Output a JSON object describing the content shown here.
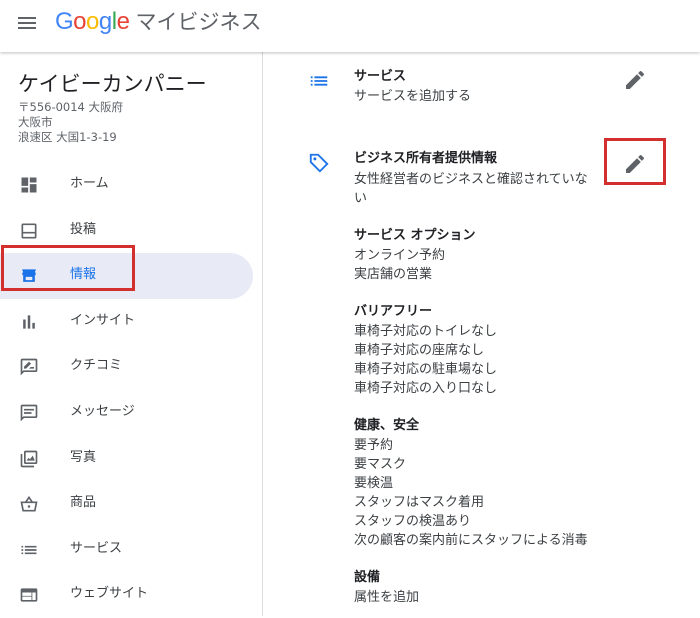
{
  "header": {
    "logo_letters": [
      {
        "ch": "G",
        "color": "#4285F4"
      },
      {
        "ch": "o",
        "color": "#EA4335"
      },
      {
        "ch": "o",
        "color": "#FBBC05"
      },
      {
        "ch": "g",
        "color": "#4285F4"
      },
      {
        "ch": "l",
        "color": "#34A853"
      },
      {
        "ch": "e",
        "color": "#EA4335"
      }
    ],
    "product": "マイビジネス"
  },
  "business": {
    "name": "ケイビーカンパニー",
    "address": [
      "〒556-0014 大阪府",
      "大阪市",
      "浪速区 大国1-3-19"
    ]
  },
  "nav": [
    {
      "label": "ホーム",
      "icon": "dashboard-icon"
    },
    {
      "label": "投稿",
      "icon": "post-icon"
    },
    {
      "label": "情報",
      "icon": "storefront-icon",
      "active": true
    },
    {
      "label": "インサイト",
      "icon": "bar-chart-icon"
    },
    {
      "label": "クチコミ",
      "icon": "review-icon"
    },
    {
      "label": "メッセージ",
      "icon": "message-icon"
    },
    {
      "label": "写真",
      "icon": "photo-icon"
    },
    {
      "label": "商品",
      "icon": "basket-icon"
    },
    {
      "label": "サービス",
      "icon": "list-icon"
    },
    {
      "label": "ウェブサイト",
      "icon": "web-icon"
    }
  ],
  "main": {
    "service": {
      "title": "サービス",
      "line": "サービスを追加する",
      "icon": "list-icon"
    },
    "attributes": {
      "title": "ビジネス所有者提供情報",
      "icon": "tag-icon",
      "description": [
        "女性経営者のビジネスと確認されていな",
        "い"
      ],
      "groups": [
        {
          "title": "サービス オプション",
          "items": [
            "オンライン予約",
            "実店舗の営業"
          ]
        },
        {
          "title": "バリアフリー",
          "items": [
            "車椅子対応のトイレなし",
            "車椅子対応の座席なし",
            "車椅子対応の駐車場なし",
            "車椅子対応の入り口なし"
          ]
        },
        {
          "title": "健康、安全",
          "items": [
            "要予約",
            "要マスク",
            "要検温",
            "スタッフはマスク着用",
            "スタッフの検温あり",
            "次の顧客の案内前にスタッフによる消毒"
          ]
        },
        {
          "title": "設備",
          "items": [
            "属性を追加"
          ]
        }
      ]
    }
  }
}
